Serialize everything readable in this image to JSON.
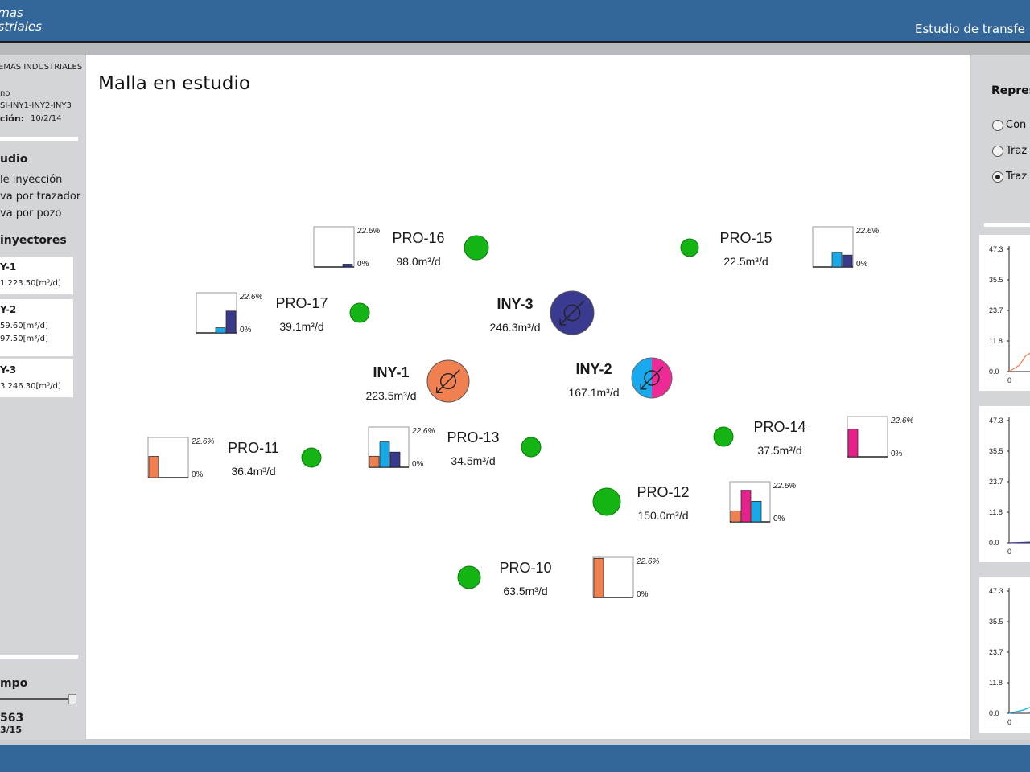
{
  "header": {
    "logo_line1": "emas",
    "logo_line2": "ustriales",
    "title": "Estudio de transfe"
  },
  "left_panel": {
    "company": "EMAS INDUSTRIALES",
    "line_name": "no",
    "line_code": "SI-INY1-INY2-INY3",
    "date_label": "ción:",
    "date_value": "10/2/14",
    "section_study": "udio",
    "menu": [
      "le inyección",
      "va por trazador",
      "va por pozo"
    ],
    "section_injectors": "inyectores",
    "injectors": [
      {
        "name": "Y-1",
        "lines": [
          "1 223.50[m³/d]"
        ]
      },
      {
        "name": "Y-2",
        "lines": [
          "59.60[m³/d]",
          "97.50[m³/d]"
        ]
      },
      {
        "name": "Y-3",
        "lines": [
          "3 246.30[m³/d]"
        ]
      }
    ],
    "section_time": "mpo",
    "time_value": "563",
    "time_date": "3/15",
    "slider_fraction": 1.0
  },
  "main": {
    "title": "Malla en estudio",
    "colors": {
      "producer": "#14b414",
      "iny1": "#f08050",
      "iny2_a": "#18aaee",
      "iny2_b": "#ee2a96",
      "iny3": "#3a3a90",
      "bar_iny1": "#f08050",
      "bar_iny2_cyan": "#18a9e6",
      "bar_iny2_pink": "#e8208c",
      "bar_iny3": "#3a3a8c"
    },
    "chart_scale": {
      "max_label": "22.6%",
      "min_label": "0%",
      "max": 22.6
    },
    "producers": [
      {
        "name": "PRO-16",
        "rate": "98.0m³/d",
        "bars": [
          {
            "tracer": "iny3",
            "value": 1.6
          }
        ]
      },
      {
        "name": "PRO-15",
        "rate": "22.5m³/d",
        "bars": [
          {
            "tracer": "iny2_cyan",
            "value": 8.3
          },
          {
            "tracer": "iny3",
            "value": 6.7
          }
        ]
      },
      {
        "name": "PRO-17",
        "rate": "39.1m³/d",
        "bars": [
          {
            "tracer": "iny2_cyan",
            "value": 2.9
          },
          {
            "tracer": "iny3",
            "value": 12.3
          }
        ]
      },
      {
        "name": "PRO-11",
        "rate": "36.4m³/d",
        "bars": [
          {
            "tracer": "iny1",
            "value": 12.0
          }
        ]
      },
      {
        "name": "PRO-13",
        "rate": "34.5m³/d",
        "bars": [
          {
            "tracer": "iny1",
            "value": 6.2
          },
          {
            "tracer": "iny2_cyan",
            "value": 14.2
          },
          {
            "tracer": "iny3",
            "value": 8.5
          }
        ]
      },
      {
        "name": "PRO-14",
        "rate": "37.5m³/d",
        "bars": [
          {
            "tracer": "iny2_pink",
            "value": 15.5
          }
        ]
      },
      {
        "name": "PRO-12",
        "rate": "150.0m³/d",
        "bars": [
          {
            "tracer": "iny1",
            "value": 6.2
          },
          {
            "tracer": "iny2_pink",
            "value": 17.8
          },
          {
            "tracer": "iny2_cyan",
            "value": 11.6
          }
        ]
      },
      {
        "name": "PRO-10",
        "rate": "63.5m³/d",
        "bars": [
          {
            "tracer": "iny1",
            "value": 22.0
          }
        ]
      }
    ],
    "injectors": [
      {
        "name": "INY-3",
        "rate": "246.3m³/d"
      },
      {
        "name": "INY-1",
        "rate": "223.5m³/d"
      },
      {
        "name": "INY-2",
        "rate": "167.1m³/d"
      }
    ]
  },
  "right_panel": {
    "title": "Repres",
    "options": [
      {
        "label": "Con",
        "selected": false
      },
      {
        "label": "Traz",
        "selected": false
      },
      {
        "label": "Traz",
        "selected": true
      }
    ],
    "mini_chart": {
      "y_ticks": [
        "47.3",
        "35.5",
        "23.7",
        "11.8",
        "0.0"
      ],
      "x_tick": "0",
      "colors": [
        "#f08050",
        "#3a3a8c",
        "#18a9e6"
      ]
    }
  }
}
